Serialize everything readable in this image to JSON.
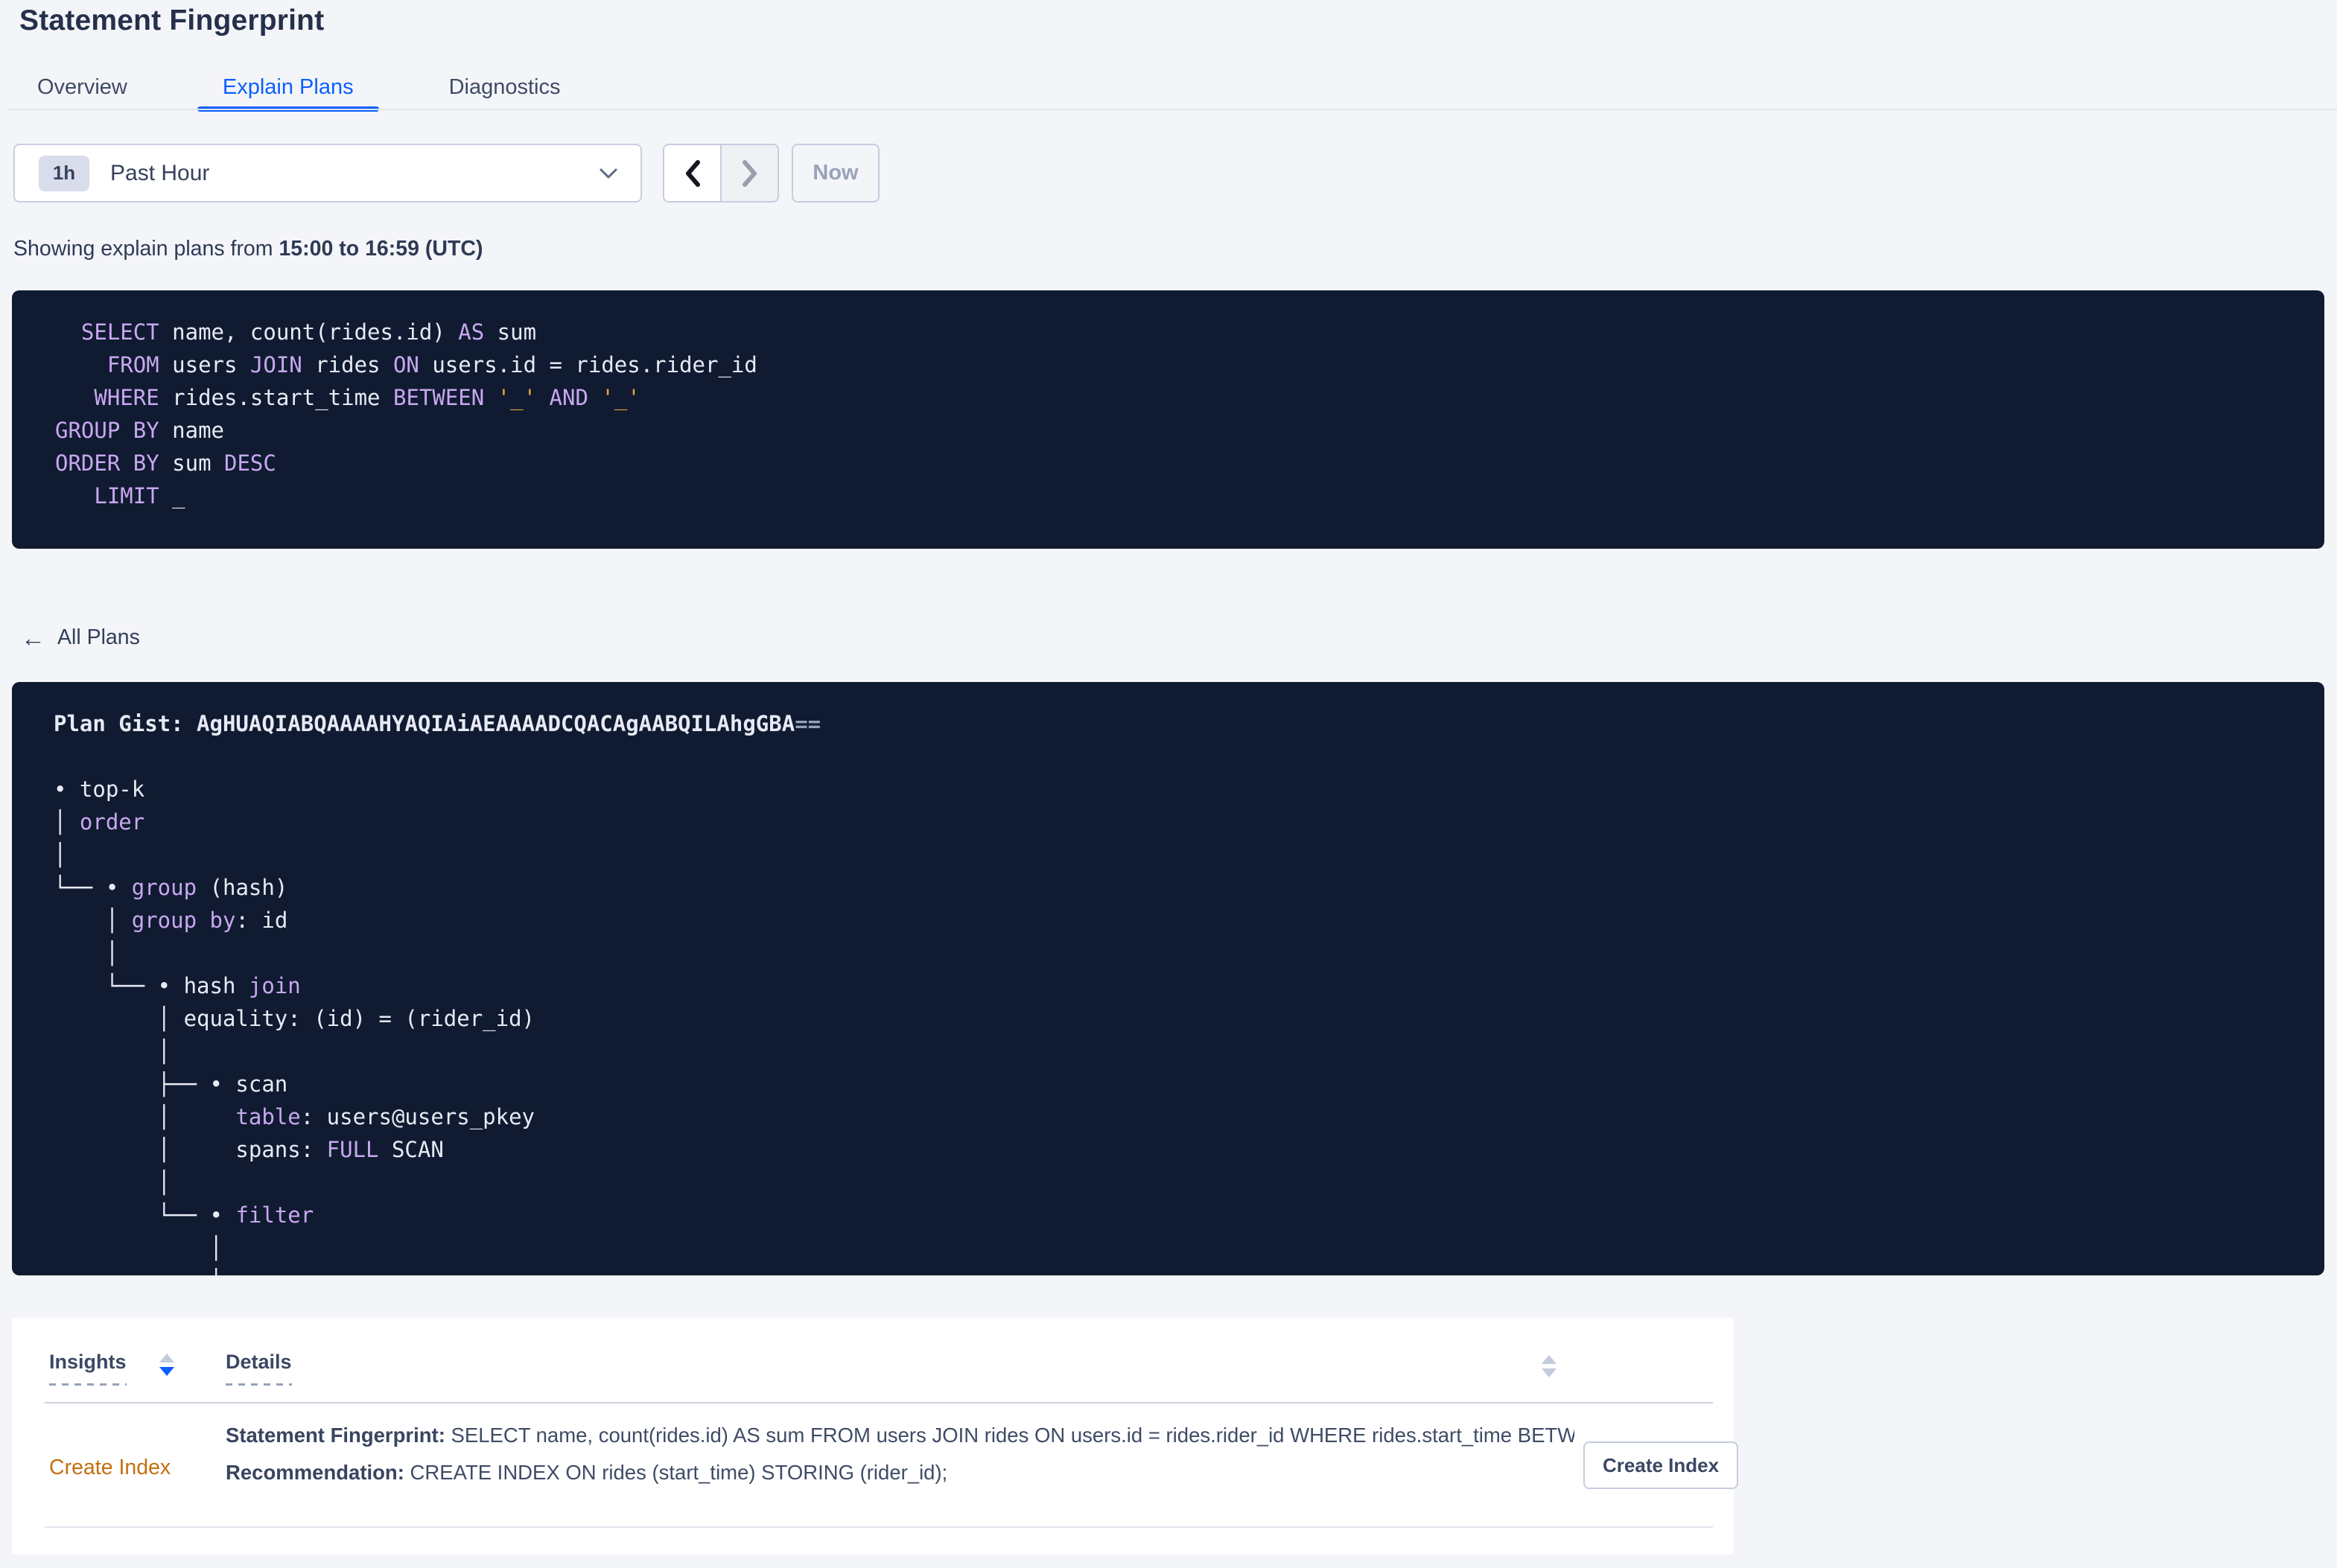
{
  "page": {
    "title": "Statement Fingerprint"
  },
  "colors": {
    "accent_blue": "#0b5fff",
    "code_bg": "#101b31",
    "code_text": "#e7eaf4",
    "code_keyword": "#c8a7f0",
    "code_literal": "#eda33f",
    "code_dim": "#93a0ba",
    "insight_orange": "#c46f0e"
  },
  "tabs": [
    {
      "label": "Overview",
      "active": false
    },
    {
      "label": "Explain Plans",
      "active": true
    },
    {
      "label": "Diagnostics",
      "active": false
    }
  ],
  "time_picker": {
    "badge": "1h",
    "label": "Past Hour",
    "now_label": "Now",
    "chevron_down_icon": "chevron-down",
    "prev_icon": "chevron-left",
    "next_icon": "chevron-right"
  },
  "showing": {
    "prefix": "Showing explain plans from ",
    "range": "15:00 to 16:59 (UTC)"
  },
  "sql_block": {
    "lines": [
      [
        [
          "id",
          "  "
        ],
        [
          "kw",
          "SELECT"
        ],
        [
          "id",
          " name, count(rides.id) "
        ],
        [
          "kw",
          "AS"
        ],
        [
          "id",
          " sum"
        ]
      ],
      [
        [
          "id",
          "    "
        ],
        [
          "kw",
          "FROM"
        ],
        [
          "id",
          " users "
        ],
        [
          "kw",
          "JOIN"
        ],
        [
          "id",
          " rides "
        ],
        [
          "kw",
          "ON"
        ],
        [
          "id",
          " users.id = rides.rider_id"
        ]
      ],
      [
        [
          "id",
          "   "
        ],
        [
          "kw",
          "WHERE"
        ],
        [
          "id",
          " rides.start_time "
        ],
        [
          "kw",
          "BETWEEN"
        ],
        [
          "id",
          " "
        ],
        [
          "str",
          "'_'"
        ],
        [
          "id",
          " "
        ],
        [
          "kw",
          "AND"
        ],
        [
          "id",
          " "
        ],
        [
          "str",
          "'_'"
        ]
      ],
      [
        [
          "kw",
          "GROUP BY"
        ],
        [
          "id",
          " name"
        ]
      ],
      [
        [
          "kw",
          "ORDER BY"
        ],
        [
          "id",
          " sum "
        ],
        [
          "kw",
          "DESC"
        ]
      ],
      [
        [
          "id",
          "   "
        ],
        [
          "kw",
          "LIMIT"
        ],
        [
          "id",
          " _"
        ]
      ]
    ]
  },
  "all_plans": {
    "arrow": "←",
    "label": "All Plans"
  },
  "plan_block": {
    "lines": [
      [
        [
          "b",
          "Plan Gist: AgHUAQIABQAAAAHYAQIAiAEAAAADCQACAgAABQILAhgGBA"
        ],
        [
          "bdim",
          "=="
        ]
      ],
      [],
      [
        [
          "id",
          "• top-k"
        ]
      ],
      [
        [
          "id",
          "│ "
        ],
        [
          "kw",
          "order"
        ]
      ],
      [
        [
          "id",
          "│"
        ]
      ],
      [
        [
          "id",
          "└── • "
        ],
        [
          "kw",
          "group"
        ],
        [
          "id",
          " (hash)"
        ]
      ],
      [
        [
          "id",
          "    │ "
        ],
        [
          "kw",
          "group by"
        ],
        [
          "id",
          ": id"
        ]
      ],
      [
        [
          "id",
          "    │"
        ]
      ],
      [
        [
          "id",
          "    └── • hash "
        ],
        [
          "kw",
          "join"
        ]
      ],
      [
        [
          "id",
          "        │ equality: (id) = (rider_id)"
        ]
      ],
      [
        [
          "id",
          "        │"
        ]
      ],
      [
        [
          "id",
          "        ├── • scan"
        ]
      ],
      [
        [
          "id",
          "        │     "
        ],
        [
          "kw",
          "table"
        ],
        [
          "id",
          ": users@users_pkey"
        ]
      ],
      [
        [
          "id",
          "        │     spans: "
        ],
        [
          "kw",
          "FULL"
        ],
        [
          "id",
          " SCAN"
        ]
      ],
      [
        [
          "id",
          "        │"
        ]
      ],
      [
        [
          "id",
          "        └── • "
        ],
        [
          "kw",
          "filter"
        ]
      ],
      [
        [
          "id",
          "            │"
        ]
      ],
      [
        [
          "id",
          "            │"
        ]
      ]
    ]
  },
  "insights_table": {
    "columns": [
      {
        "label": "Insights"
      },
      {
        "label": "Details"
      }
    ],
    "rows": [
      {
        "insight": "Create Index",
        "details": [
          {
            "label": "Statement Fingerprint:",
            "text": " SELECT name, count(rides.id) AS sum FROM users JOIN rides ON users.id = rides.rider_id WHERE rides.start_time BETWEEN '_…"
          },
          {
            "label": "Recommendation:",
            "text": " CREATE INDEX ON rides (start_time) STORING (rider_id);"
          }
        ],
        "action": "Create Index"
      }
    ]
  }
}
